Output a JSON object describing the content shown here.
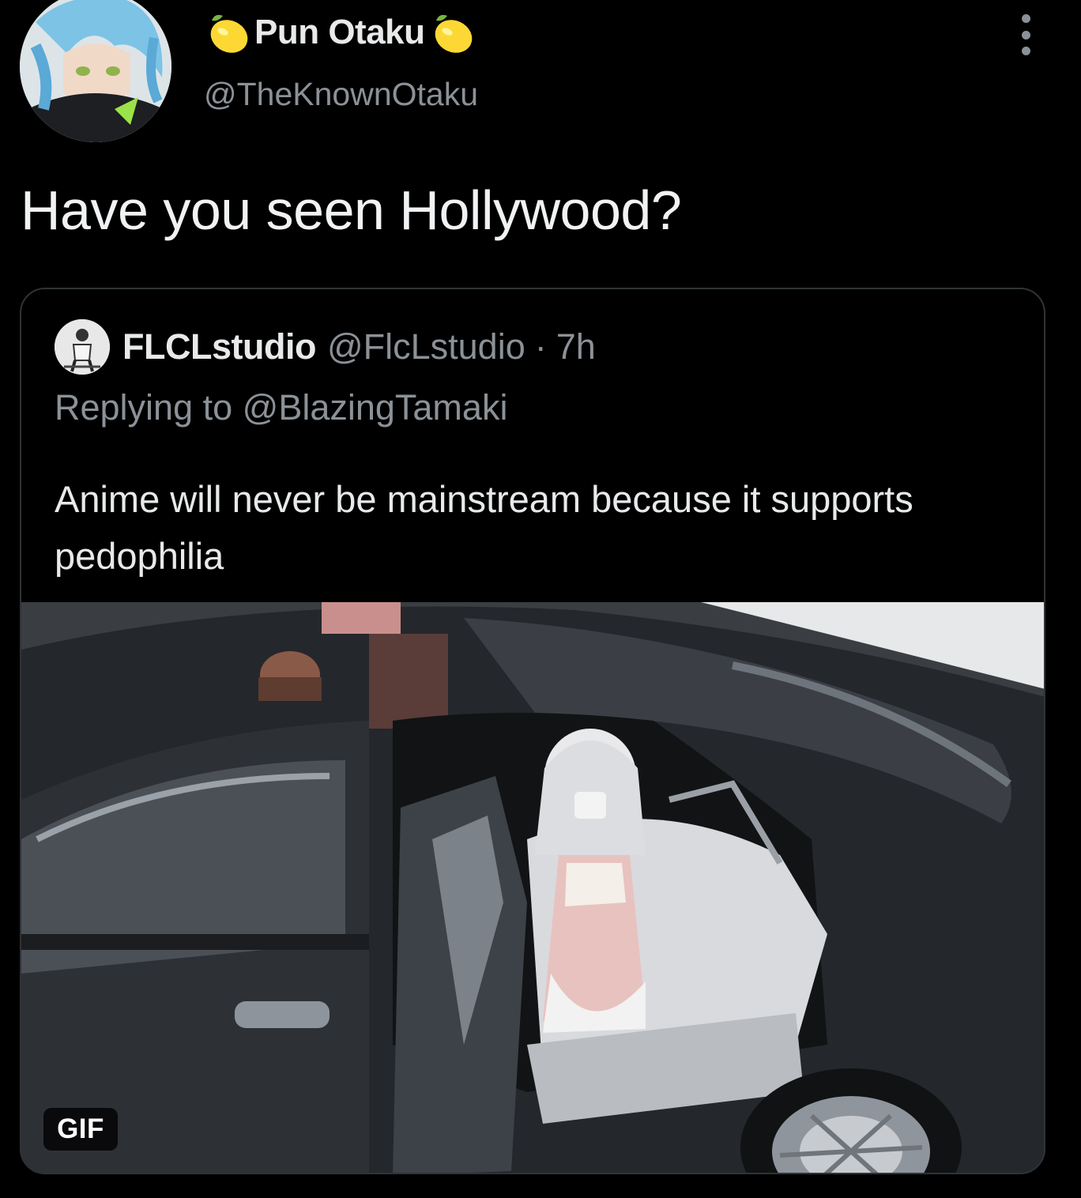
{
  "tweet": {
    "author": {
      "display_name": "Pun Otaku",
      "handle": "@TheKnownOtaku",
      "name_emoji": "lemon-icon"
    },
    "text": "Have you seen Hollywood?",
    "more_icon": "more-options-icon"
  },
  "quoted_tweet": {
    "author": {
      "display_name": "FLCLstudio",
      "handle": "@FlcLstudio"
    },
    "separator": "·",
    "time": "7h",
    "replying_to": "Replying to @BlazingTamaki",
    "text": "Anime will never be mainstream because it supports pedophilia",
    "media": {
      "type": "gif",
      "badge": "GIF"
    }
  },
  "colors": {
    "background": "#000000",
    "primary_text": "#e7e9ea",
    "secondary_text": "#8b9197",
    "border": "#2f3336"
  }
}
